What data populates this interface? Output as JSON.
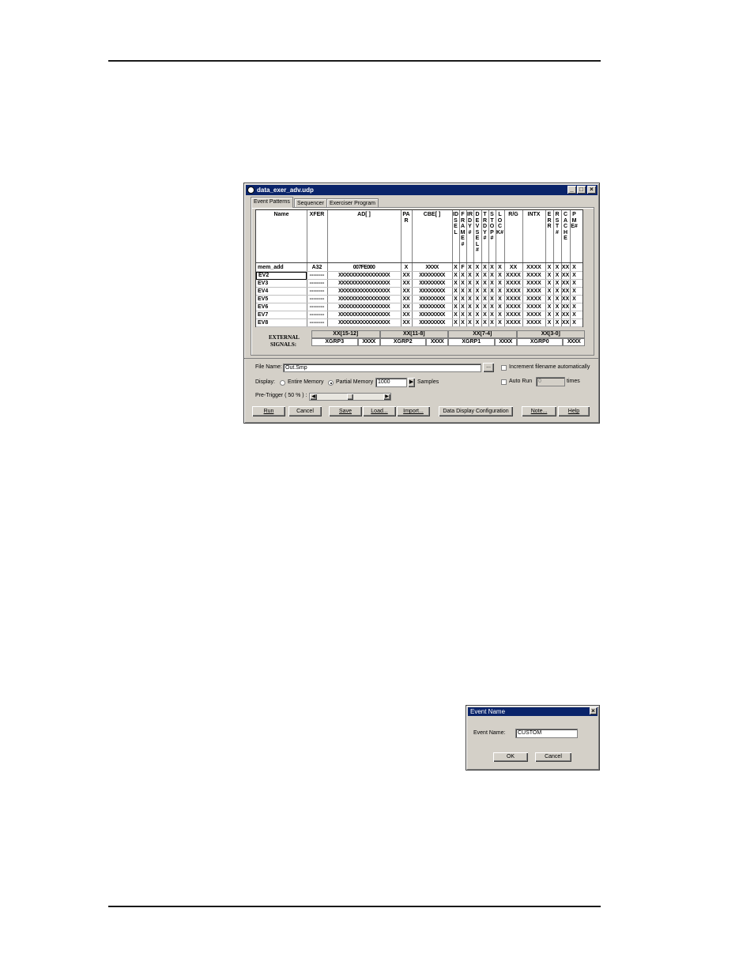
{
  "main_window": {
    "title": "data_exer_adv.udp",
    "controls": {
      "minimize": "_",
      "maximize": "□",
      "close": "×"
    },
    "tabs": [
      {
        "label": "Event Patterns"
      },
      {
        "label": "Sequencer"
      },
      {
        "label": "Exerciser Program"
      }
    ],
    "columns": [
      {
        "label": "Name"
      },
      {
        "label": "XFER"
      },
      {
        "label": "AD[ ]"
      },
      {
        "label": "PAR"
      },
      {
        "label": "CBE[ ]"
      },
      {
        "label": "IDSEL"
      },
      {
        "label": "FRAME#"
      },
      {
        "label": "IRDY#"
      },
      {
        "label": "DEVSEL#"
      },
      {
        "label": "TRDY#"
      },
      {
        "label": "STOP#"
      },
      {
        "label": "LOCK#"
      },
      {
        "label": "R/G"
      },
      {
        "label": "INTX"
      },
      {
        "label": "ERR"
      },
      {
        "label": "RST#"
      },
      {
        "label": "CACHE"
      },
      {
        "label": "PME#"
      }
    ],
    "rows": [
      [
        "mem_add",
        "A32",
        "007FE000",
        "X",
        "XXXX",
        "X",
        "F",
        "X",
        "X",
        "X",
        "X",
        "X",
        "XX",
        "XXXX",
        "X",
        "X",
        "XX",
        "X"
      ],
      [
        "EV2",
        "--------",
        "XXXXXXXXXXXXXXXX",
        "XX",
        "XXXXXXXX",
        "X",
        "X",
        "X",
        "X",
        "X",
        "X",
        "X",
        "XXXX",
        "XXXX",
        "X",
        "X",
        "XX",
        "X"
      ],
      [
        "EV3",
        "--------",
        "XXXXXXXXXXXXXXXX",
        "XX",
        "XXXXXXXX",
        "X",
        "X",
        "X",
        "X",
        "X",
        "X",
        "X",
        "XXXX",
        "XXXX",
        "X",
        "X",
        "XX",
        "X"
      ],
      [
        "EV4",
        "--------",
        "XXXXXXXXXXXXXXXX",
        "XX",
        "XXXXXXXX",
        "X",
        "X",
        "X",
        "X",
        "X",
        "X",
        "X",
        "XXXX",
        "XXXX",
        "X",
        "X",
        "XX",
        "X"
      ],
      [
        "EV5",
        "--------",
        "XXXXXXXXXXXXXXXX",
        "XX",
        "XXXXXXXX",
        "X",
        "X",
        "X",
        "X",
        "X",
        "X",
        "X",
        "XXXX",
        "XXXX",
        "X",
        "X",
        "XX",
        "X"
      ],
      [
        "EV6",
        "--------",
        "XXXXXXXXXXXXXXXX",
        "XX",
        "XXXXXXXX",
        "X",
        "X",
        "X",
        "X",
        "X",
        "X",
        "X",
        "XXXX",
        "XXXX",
        "X",
        "X",
        "XX",
        "X"
      ],
      [
        "EV7",
        "--------",
        "XXXXXXXXXXXXXXXX",
        "XX",
        "XXXXXXXX",
        "X",
        "X",
        "X",
        "X",
        "X",
        "X",
        "X",
        "XXXX",
        "XXXX",
        "X",
        "X",
        "XX",
        "X"
      ],
      [
        "EV8",
        "--------",
        "XXXXXXXXXXXXXXXX",
        "XX",
        "XXXXXXXX",
        "X",
        "X",
        "X",
        "X",
        "X",
        "X",
        "X",
        "XXXX",
        "XXXX",
        "X",
        "X",
        "XX",
        "X"
      ]
    ],
    "external": {
      "label_line1": "EXTERNAL",
      "label_line2": "SIGNALS:",
      "groups": [
        {
          "header": "XX[15-12]",
          "name": "XGRP3",
          "value": "XXXX"
        },
        {
          "header": "XX[11-8]",
          "name": "XGRP2",
          "value": "XXXX"
        },
        {
          "header": "XX[7-4]",
          "name": "XGRP1",
          "value": "XXXX"
        },
        {
          "header": "XX[3-0]",
          "name": "XGRP0",
          "value": "XXXX"
        }
      ]
    },
    "file_name_label": "File Name:",
    "file_name_value": "Out.Smp",
    "browse_label": "...",
    "increment_label": "Increment filename automatically",
    "display_label": "Display:",
    "entire_memory_label": "Entire Memory",
    "partial_memory_label": "Partial Memory",
    "samples_value": "1000",
    "samples_label": "Samples",
    "auto_run_label": "Auto Run",
    "auto_run_value": "0",
    "times_label": "times",
    "pre_trigger_label": "Pre-Trigger ( 50 % ) :",
    "pre_trigger_percent": 50,
    "buttons": {
      "run": "Run",
      "cancel": "Cancel",
      "save": "Save",
      "load": "Load...",
      "import": "Import...",
      "data_display": "Data Display Configuration",
      "note": "Note...",
      "help": "Help"
    }
  },
  "event_name_dialog": {
    "title": "Event Name",
    "close": "×",
    "field_label": "Event Name:",
    "field_value": "CUSTOM",
    "ok": "OK",
    "cancel": "Cancel"
  }
}
